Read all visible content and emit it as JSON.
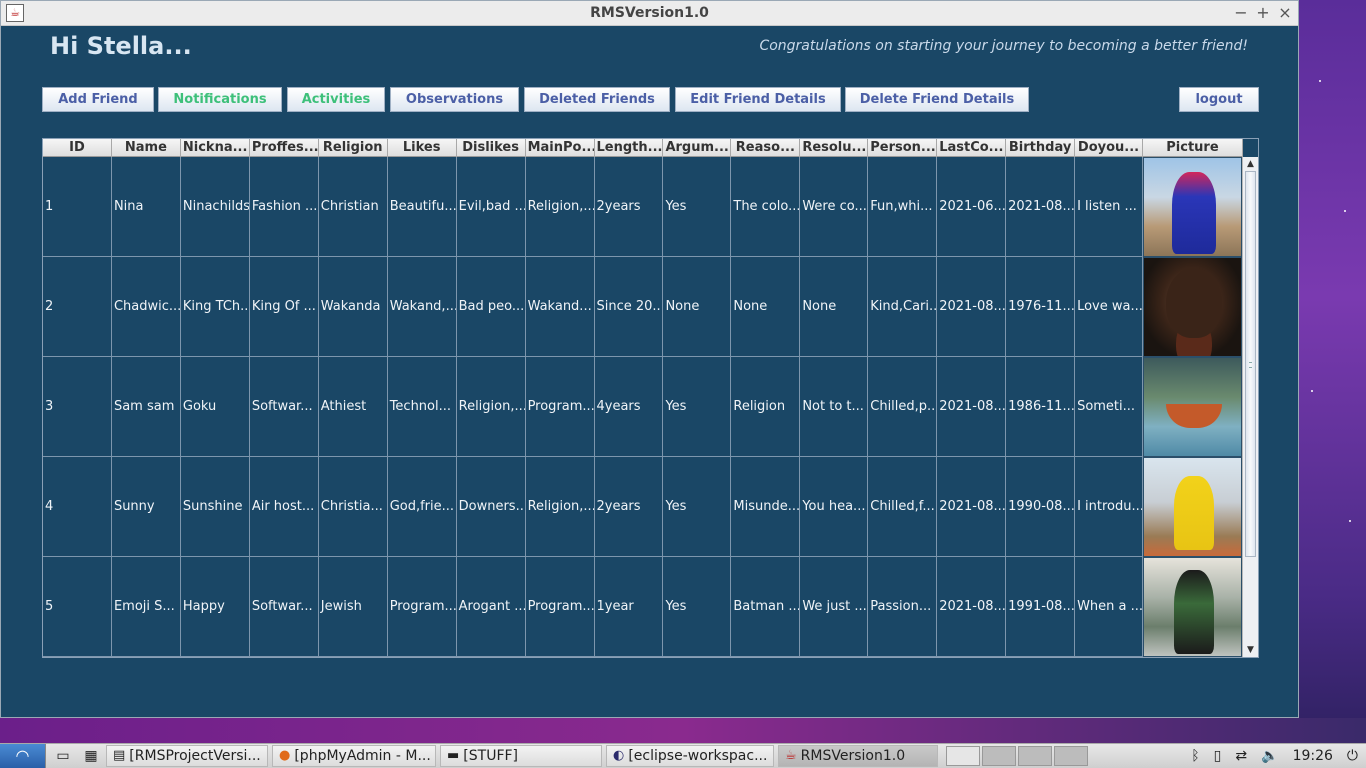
{
  "window": {
    "title": "RMSVersion1.0"
  },
  "header": {
    "greeting": "Hi Stella...",
    "slogan": "Congratulations on starting your journey to becoming a better friend!"
  },
  "toolbar": {
    "add_friend": "Add Friend",
    "notifications": "Notifications",
    "activities": "Activities",
    "observations": "Observations",
    "deleted_friends": "Deleted Friends",
    "edit_friend_details": "Edit Friend Details",
    "delete_friend_details": "Delete Friend Details",
    "logout": "logout"
  },
  "colors": {
    "window_bg": "#1a4766",
    "button_text": "#4b5fa6",
    "button_text_green": "#3dc07a"
  },
  "table": {
    "columns": [
      "ID",
      "Name",
      "Nickna...",
      "Proffes...",
      "Religion",
      "Likes",
      "Dislikes",
      "MainPo...",
      "Length...",
      "Argum...",
      "Reaso...",
      "Resolu...",
      "Person...",
      "LastCo...",
      "Birthday",
      "Doyou...",
      "Picture"
    ],
    "rows": [
      [
        "1",
        "Nina",
        "Ninachilds",
        "Fashion ...",
        "Christian",
        "Beautifu...",
        "Evil,bad ...",
        "Religion,...",
        "2years",
        "Yes",
        "The colo...",
        "Were co...",
        "Fun,whi...",
        "2021-06...",
        "2021-08...",
        "I listen ..."
      ],
      [
        "2",
        "Chadwic...",
        "King TCh...",
        "King Of ...",
        "Wakanda",
        "Wakand,...",
        "Bad peo...",
        "Wakand...",
        "Since 20...",
        "None",
        "None",
        "None",
        "Kind,Cari...",
        "2021-08...",
        "1976-11...",
        "Love wa..."
      ],
      [
        "3",
        "Sam sam",
        "Goku",
        "Softwar...",
        "Athiest",
        "Technol...",
        "Religion,...",
        "Program...",
        "4years",
        "Yes",
        "Religion",
        "Not to t...",
        "Chilled,p...",
        "2021-08...",
        "1986-11...",
        "Someti..."
      ],
      [
        "4",
        "Sunny",
        "Sunshine",
        "Air host...",
        "Christia...",
        "God,frie...",
        "Downers...",
        "Religion,...",
        "2years",
        "Yes",
        "Misunde...",
        "You hea...",
        "Chilled,f...",
        "2021-08...",
        "1990-08...",
        "I introdu..."
      ],
      [
        "5",
        "Emoji S...",
        "Happy",
        "Softwar...",
        "Jewish",
        "Program...",
        "Arogant ...",
        "Program...",
        "1year",
        "Yes",
        "Batman ...",
        "We just ...",
        "Passion...",
        "2021-08...",
        "1991-08...",
        "When a ..."
      ]
    ]
  },
  "taskbar": {
    "tasks": [
      "[RMSProjectVersi...",
      "[phpMyAdmin - M...",
      "[STUFF]",
      "[eclipse-workspac...",
      "RMSVersion1.0"
    ],
    "clock": "19:26"
  }
}
